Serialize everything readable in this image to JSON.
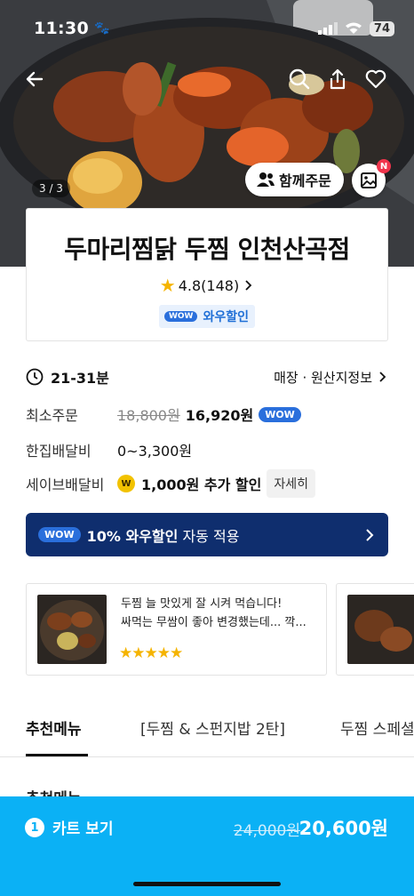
{
  "status_bar": {
    "time": "11:30",
    "battery": "74"
  },
  "hero": {
    "image_counter": "3 / 3",
    "together_order_label": "함께주문",
    "photo_badge": "N"
  },
  "store": {
    "name": "두마리찜닭 두찜 인천산곡점",
    "rating": "4.8(148)",
    "wow_tag": "WOW",
    "wow_discount_label": "와우할인"
  },
  "info": {
    "delivery_time": "21-31분",
    "store_origin_link": "매장 · 원산지정보",
    "min_order_label": "최소주문",
    "min_order_original": "18,800원",
    "min_order_price": "16,920원",
    "min_order_wow": "WOW",
    "delivery_fee_label": "한집배달비",
    "delivery_fee_value": "0~3,300원",
    "save_delivery_label": "세이브배달비",
    "save_delivery_value": "1,000원 추가 할인",
    "detail_button": "자세히"
  },
  "banner": {
    "wow_tag": "WOW",
    "strong_text": "10% 와우할인",
    "text": " 자동 적용"
  },
  "reviews": [
    {
      "line1": "두찜 늘 맛있게 잘 시켜 먹습니다!",
      "line2": "싸먹는 무쌈이 좋아 변경했는데... 깍...",
      "stars": "★★★★★"
    }
  ],
  "tabs": [
    "추천메뉴",
    "[두찜 & 스펀지밥 2탄]",
    "두찜 스페셜"
  ],
  "section_title": "추천메뉴",
  "cart": {
    "count": "1",
    "view_label": "카트 보기",
    "original_price": "24,000원",
    "price": "20,600원"
  },
  "colors": {
    "accent": "#0bb1f5",
    "wow_blue": "#2a6fdc",
    "banner_navy": "#0f2e6e",
    "star": "#f5b400"
  }
}
